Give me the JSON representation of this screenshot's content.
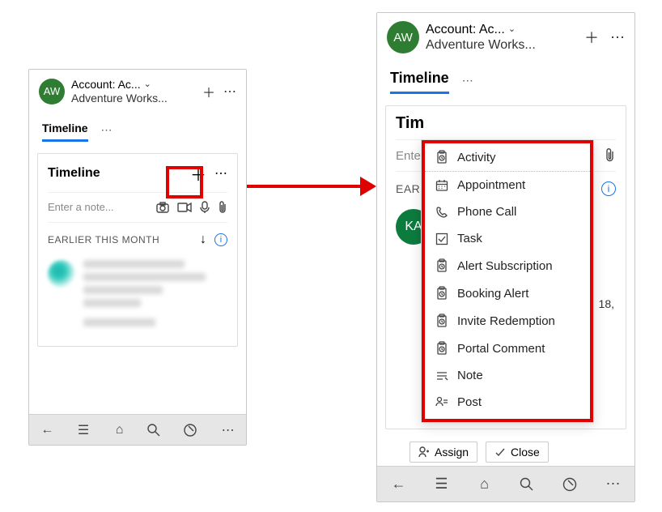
{
  "header": {
    "avatar_initials": "AW",
    "title": "Account: Ac...",
    "subtitle": "Adventure Works..."
  },
  "tabs": {
    "timeline_label": "Timeline"
  },
  "card": {
    "title_left": "Timeline",
    "title_right": "Tim",
    "note_placeholder_left": "Enter a note...",
    "note_placeholder_right": "Ente",
    "earlier_label_left": "EARLIER THIS MONTH",
    "earlier_label_right": "EAR"
  },
  "right_extra": {
    "ka_initials": "KA",
    "date_fragment": "18,",
    "assign_label": "Assign",
    "close_label": "Close"
  },
  "menu": {
    "items": [
      {
        "icon": "clipboard",
        "label": "Activity"
      },
      {
        "icon": "calendar",
        "label": "Appointment"
      },
      {
        "icon": "phone",
        "label": "Phone Call"
      },
      {
        "icon": "check",
        "label": "Task"
      },
      {
        "icon": "clipboard",
        "label": "Alert Subscription"
      },
      {
        "icon": "clipboard",
        "label": "Booking Alert"
      },
      {
        "icon": "clipboard",
        "label": "Invite Redemption"
      },
      {
        "icon": "clipboard",
        "label": "Portal Comment"
      },
      {
        "icon": "note",
        "label": "Note"
      },
      {
        "icon": "post",
        "label": "Post"
      }
    ]
  }
}
